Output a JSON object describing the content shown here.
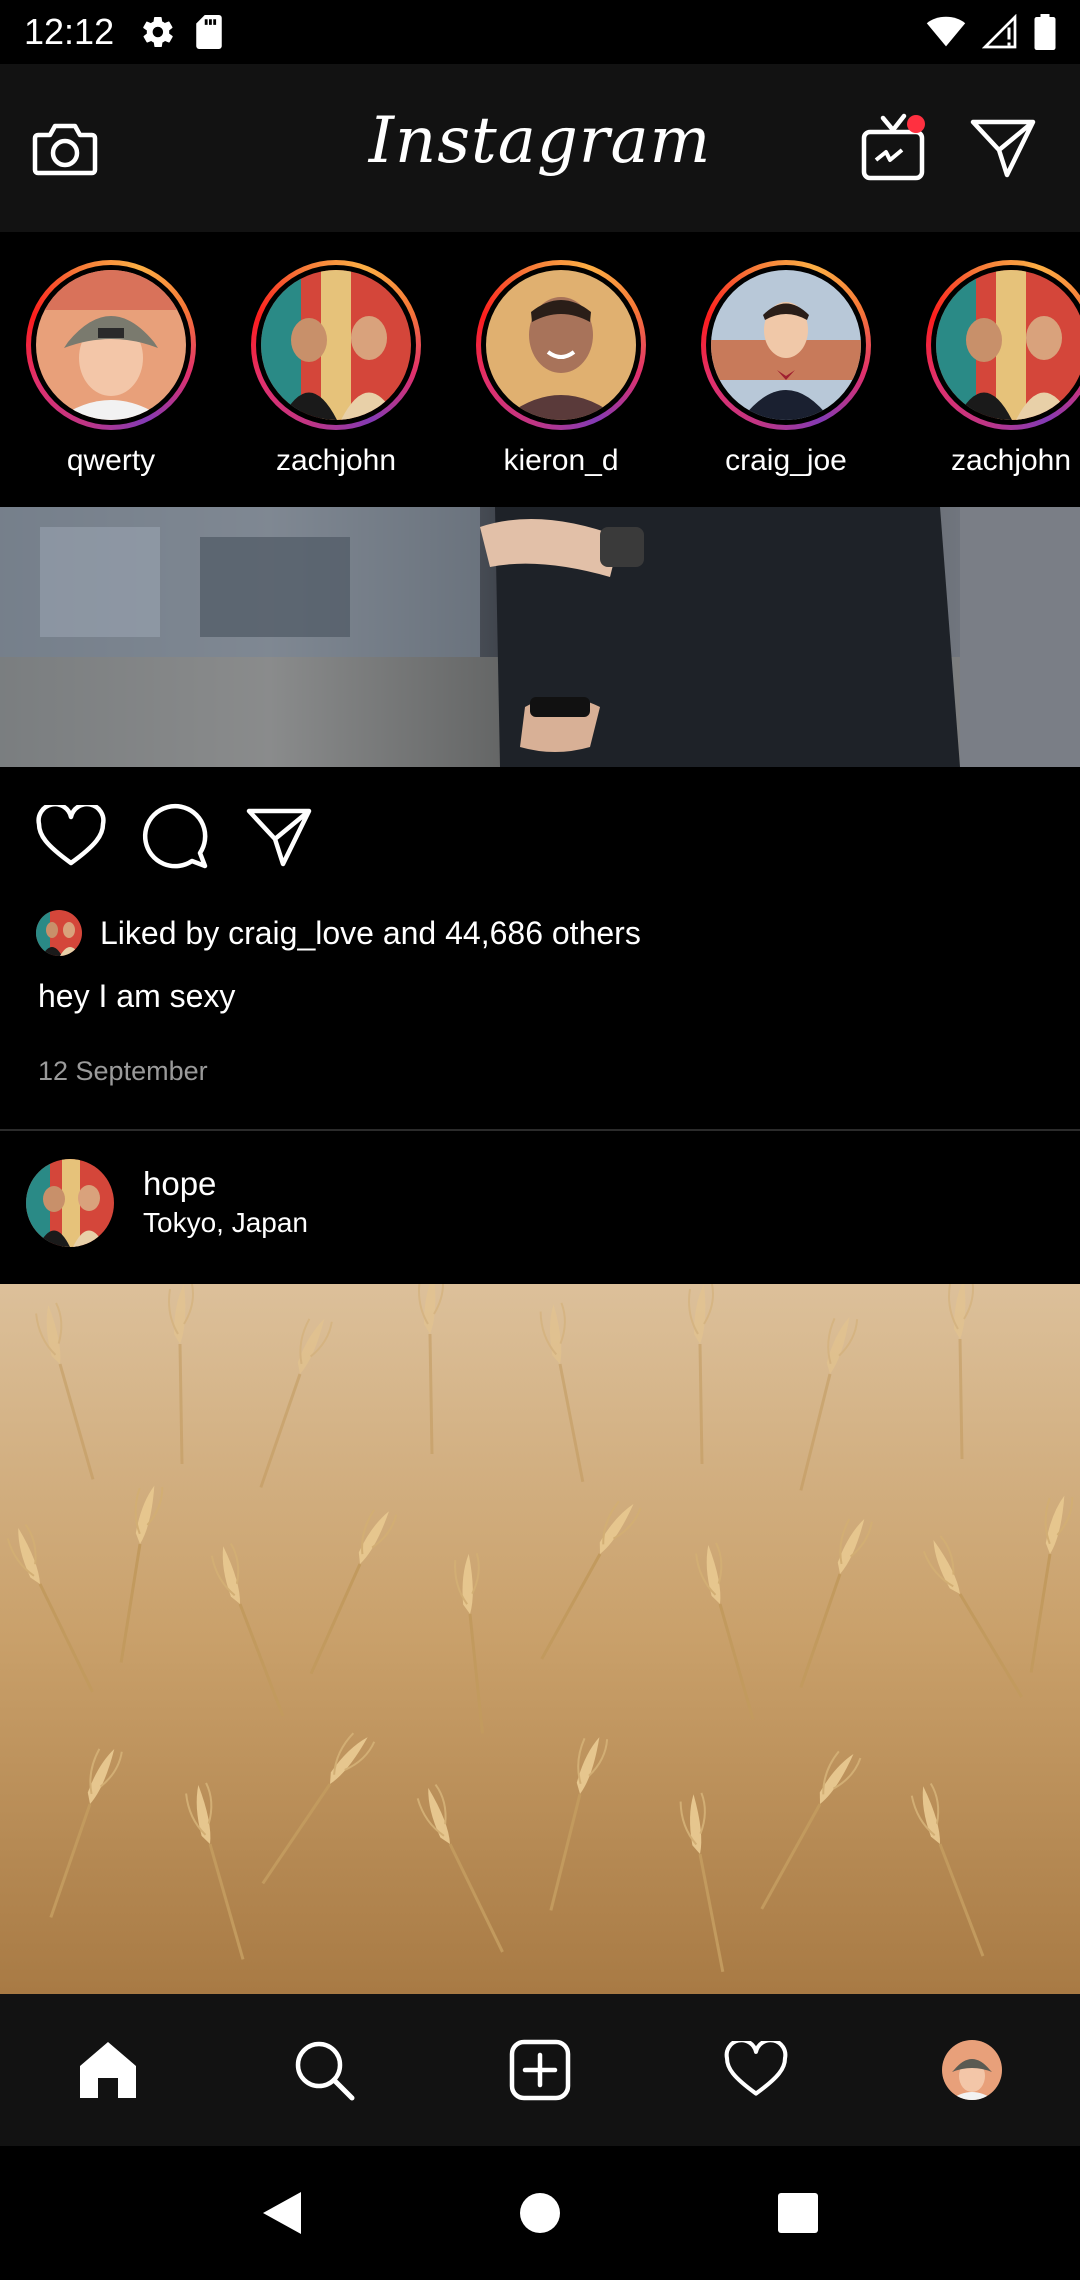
{
  "status_bar": {
    "time": "12:12",
    "left_icons": [
      "gear-icon",
      "sd-card-icon"
    ],
    "right_icons": [
      "wifi-icon",
      "signal-icon",
      "battery-icon"
    ]
  },
  "header": {
    "logo_text": "Instagram",
    "left_icon": "camera-icon",
    "right_icons": [
      "igtv-icon",
      "direct-message-icon"
    ],
    "igtv_badge_color": "#ff3040"
  },
  "stories": [
    {
      "username": "qwerty"
    },
    {
      "username": "zachjohn"
    },
    {
      "username": "kieron_d"
    },
    {
      "username": "craig_joe"
    },
    {
      "username": "zachjohn"
    }
  ],
  "post1": {
    "action_icons": [
      "heart-icon",
      "comment-icon",
      "share-icon"
    ],
    "likes_text": "Liked by craig_love and 44,686 others",
    "caption": "hey I am sexy",
    "date": "12 September"
  },
  "post2": {
    "username": "hope",
    "location": "Tokyo, Japan"
  },
  "bottom_nav": {
    "items": [
      "home-icon",
      "search-icon",
      "add-post-icon",
      "activity-heart-icon",
      "profile-avatar"
    ],
    "active": "home-icon"
  },
  "system_nav": {
    "items": [
      "back-icon",
      "home-circle-icon",
      "recents-icon"
    ]
  },
  "colors": {
    "background": "#000000",
    "header_bg": "#121212",
    "text": "#ffffff",
    "muted_text": "#9a9a9a",
    "divider": "#2b2b2b"
  }
}
